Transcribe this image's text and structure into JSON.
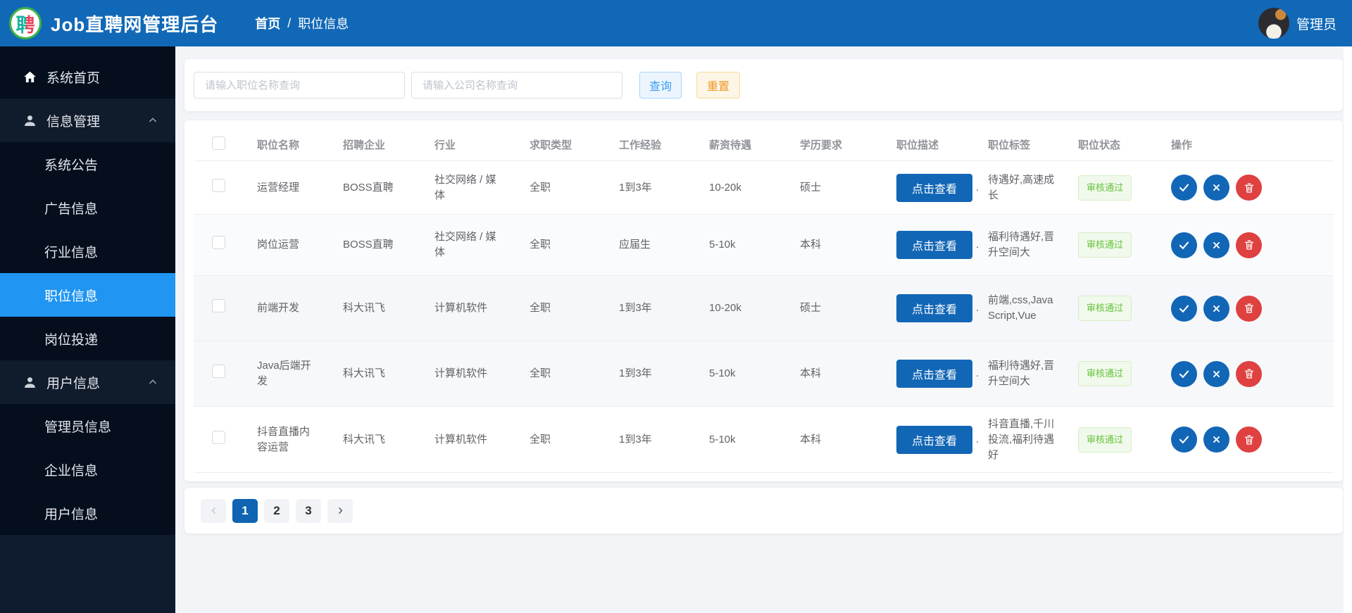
{
  "header": {
    "logo_char": "聘",
    "title": "Job直聘网管理后台",
    "breadcrumb": {
      "home": "首页",
      "separator": "/",
      "current": "职位信息"
    },
    "user_name": "管理员"
  },
  "sidebar": {
    "items": [
      {
        "label": "系统首页",
        "kind": "root",
        "icon": "home"
      },
      {
        "label": "信息管理",
        "kind": "group",
        "icon": "user",
        "expanded": true
      },
      {
        "label": "系统公告",
        "kind": "sub"
      },
      {
        "label": "广告信息",
        "kind": "sub"
      },
      {
        "label": "行业信息",
        "kind": "sub"
      },
      {
        "label": "职位信息",
        "kind": "sub",
        "active": true
      },
      {
        "label": "岗位投递",
        "kind": "sub"
      },
      {
        "label": "用户信息",
        "kind": "group",
        "icon": "user",
        "expanded": true
      },
      {
        "label": "管理员信息",
        "kind": "sub"
      },
      {
        "label": "企业信息",
        "kind": "sub"
      },
      {
        "label": "用户信息",
        "kind": "sub"
      }
    ]
  },
  "search": {
    "job_placeholder": "请输入职位名称查询",
    "company_placeholder": "请输入公司名称查询",
    "query_label": "查询",
    "reset_label": "重置"
  },
  "table": {
    "headers": [
      "职位名称",
      "招聘企业",
      "行业",
      "求职类型",
      "工作经验",
      "薪资待遇",
      "学历要求",
      "职位描述",
      "职位标签",
      "职位状态",
      "操作"
    ],
    "view_button_label": "点击查看",
    "desc_suffix": ".",
    "rows": [
      {
        "job": "运营经理",
        "company": "BOSS直聘",
        "industry": "社交网络 / 媒体",
        "type": "全职",
        "experience": "1到3年",
        "salary": "10-20k",
        "education": "硕士",
        "tags": "待遇好,高速成长",
        "status": "审核通过"
      },
      {
        "job": "岗位运营",
        "company": "BOSS直聘",
        "industry": "社交网络 / 媒体",
        "type": "全职",
        "experience": "应届生",
        "salary": "5-10k",
        "education": "本科",
        "tags": "福利待遇好,晋升空间大",
        "status": "审核通过"
      },
      {
        "job": "前端开发",
        "company": "科大讯飞",
        "industry": "计算机软件",
        "type": "全职",
        "experience": "1到3年",
        "salary": "10-20k",
        "education": "硕士",
        "tags": "前端,css,JavaScript,Vue",
        "status": "审核通过"
      },
      {
        "job": "Java后端开发",
        "company": "科大讯飞",
        "industry": "计算机软件",
        "type": "全职",
        "experience": "1到3年",
        "salary": "5-10k",
        "education": "本科",
        "tags": "福利待遇好,晋升空间大",
        "status": "审核通过"
      },
      {
        "job": "抖音直播内容运营",
        "company": "科大讯飞",
        "industry": "计算机软件",
        "type": "全职",
        "experience": "1到3年",
        "salary": "5-10k",
        "education": "本科",
        "tags": "抖音直播,千川投流,福利待遇好",
        "status": "审核通过"
      }
    ]
  },
  "pagination": {
    "pages": [
      "1",
      "2",
      "3"
    ],
    "active_page": "1"
  },
  "colors": {
    "header_blue": "#1168b7",
    "sidebar_active_blue": "#2095f2",
    "primary_button_blue": "#1266b6",
    "danger_red": "#df4040",
    "success_green": "#67c23a",
    "query_button_blue": "#3d9ef5",
    "reset_button_orange": "#ec9b28"
  }
}
